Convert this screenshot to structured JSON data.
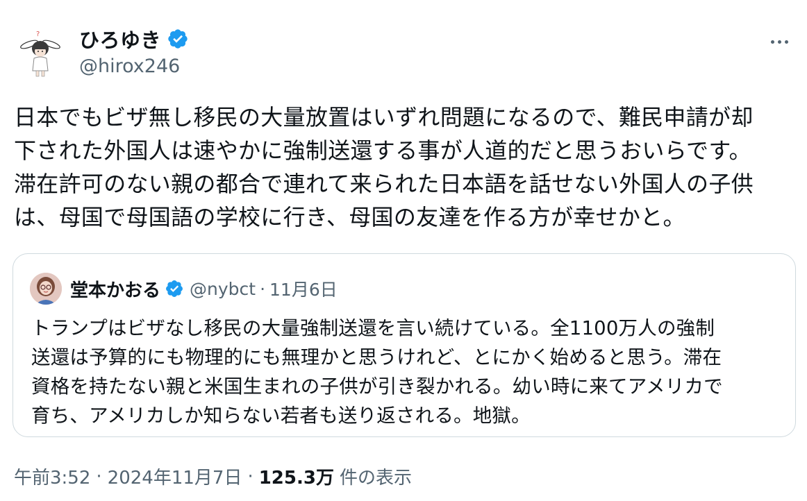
{
  "author": {
    "name": "ひろゆき",
    "handle": "@hirox246"
  },
  "tweet": {
    "text": "日本でもビザ無し移民の大量放置はいずれ問題になるので、難民申請が却\n下された外国人は速やかに強制送還する事が人道的だと思うおいらです。\n滞在許可のない親の都合で連れて来られた日本語を話せない外国人の子供\nは、母国で母国語の学校に行き、母国の友達を作る方が幸せかと。"
  },
  "quote": {
    "name": "堂本かおる",
    "handle": "@nybct",
    "separator": "·",
    "date": "11月6日",
    "text": "トランプはビザなし移民の大量強制送還を言い続けている。全1100万人の強制\n送還は予算的にも物理的にも無理かと思うけれど、とにかく始めると思う。滞在\n資格を持たない親と米国生まれの子供が引き裂かれる。幼い時に来てアメリカで\n育ち、アメリカしか知らない若者も送り返される。地獄。"
  },
  "meta": {
    "time": "午前3:52",
    "separator1": "·",
    "date": "2024年11月7日",
    "separator2": "·",
    "views": "125.3万",
    "views_label": "件の表示"
  },
  "icons": {
    "verified": "verified-badge-icon",
    "more": "more-options-icon"
  },
  "colors": {
    "verified_blue": "#1d9bf0",
    "secondary_text": "#536471",
    "primary_text": "#0f1419",
    "border": "#cfd9de"
  }
}
